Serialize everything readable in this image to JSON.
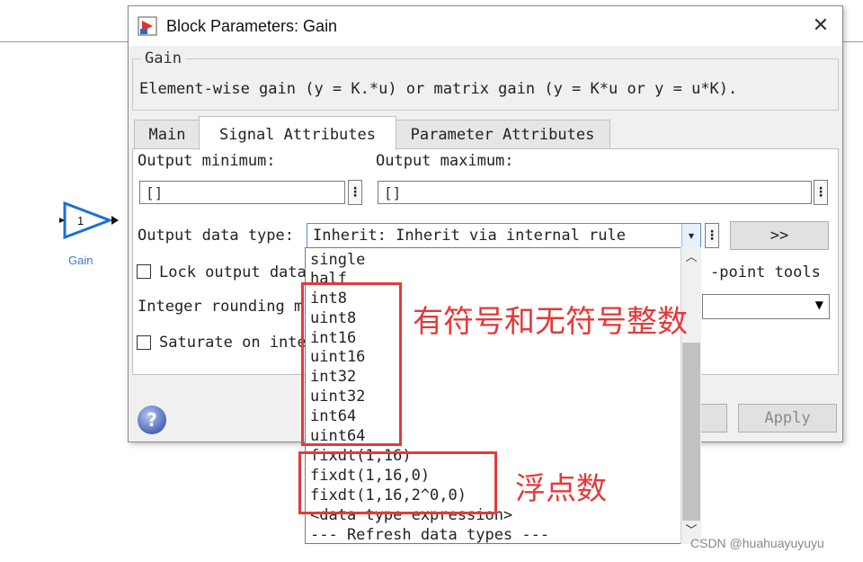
{
  "canvas": {
    "block_value": "1",
    "block_label": "Gain"
  },
  "dialog": {
    "title": "Block Parameters: Gain",
    "close_icon": "close-icon",
    "group_title": "Gain",
    "description": "Element-wise gain (y = K.*u) or matrix gain (y = K*u or y = u*K).",
    "tabs": [
      {
        "label": "Main",
        "active": false
      },
      {
        "label": "Signal Attributes",
        "active": true
      },
      {
        "label": "Parameter Attributes",
        "active": false
      }
    ],
    "output_min_label": "Output minimum:",
    "output_min_value": "[]",
    "output_max_label": "Output maximum:",
    "output_max_value": "[]",
    "output_type_label": "Output data type:",
    "output_type_value": "Inherit: Inherit via internal rule",
    "more_button": ">>",
    "lock_label": "Lock output data",
    "fixed_point_text": "-point tools",
    "rounding_label": "Integer rounding m",
    "saturate_label": "Saturate on inte",
    "apply_button": "Apply",
    "help_icon": "help-icon"
  },
  "dropdown": {
    "options": [
      "single",
      "half",
      "int8",
      "uint8",
      "int16",
      "uint16",
      "int32",
      "uint32",
      "int64",
      "uint64",
      "fixdt(1,16)",
      "fixdt(1,16,0)",
      "fixdt(1,16,2^0,0)",
      "<data type expression>",
      "--- Refresh data types ---"
    ]
  },
  "annotations": {
    "integers": "有符号和无符号整数",
    "float": "浮点数"
  },
  "watermark": "CSDN @huahuayuyuyu",
  "colors": {
    "annotation": "#e33a3a",
    "block_label": "#3a7ecf"
  }
}
